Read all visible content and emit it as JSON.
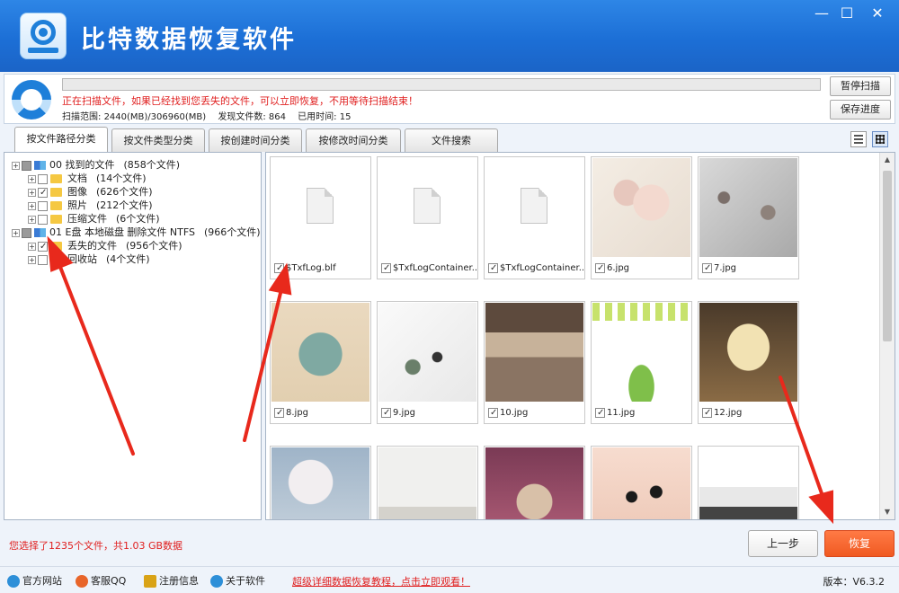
{
  "app": {
    "title": "比特数据恢复软件",
    "window_buttons": {
      "minimize": "—",
      "maximize": "☐",
      "close": "✕"
    }
  },
  "scan": {
    "progress_percent": 0,
    "message": "正在扫描文件，如果已经找到您丢失的文件，可以立即恢复，不用等待扫描结束！",
    "range_label": "扫描范围:",
    "range_value": "2440(MB)/306960(MB)",
    "found_label": "发现文件数:",
    "found_value": "864",
    "elapsed_label": "已用时间:",
    "elapsed_value": "15",
    "pause_button": "暂停扫描",
    "save_button": "保存进度"
  },
  "tabs": [
    {
      "label": "按文件路径分类",
      "active": true
    },
    {
      "label": "按文件类型分类",
      "active": false
    },
    {
      "label": "按创建时间分类",
      "active": false
    },
    {
      "label": "按修改时间分类",
      "active": false
    },
    {
      "label": "文件搜索",
      "active": false
    }
  ],
  "tree": [
    {
      "label": "00 找到的文件",
      "count": "(858个文件)",
      "level": 0,
      "icon": "drive",
      "check": "partial"
    },
    {
      "label": "文档",
      "count": "(14个文件)",
      "level": 1,
      "icon": "folder",
      "check": "off"
    },
    {
      "label": "图像",
      "count": "(626个文件)",
      "level": 1,
      "icon": "folder",
      "check": "on"
    },
    {
      "label": "照片",
      "count": "(212个文件)",
      "level": 1,
      "icon": "folder",
      "check": "off"
    },
    {
      "label": "压缩文件",
      "count": "(6个文件)",
      "level": 1,
      "icon": "folder",
      "check": "off"
    },
    {
      "label": "01 E盘 本地磁盘 删除文件 NTFS",
      "count": "(966个文件)",
      "level": 0,
      "icon": "drive",
      "check": "partial"
    },
    {
      "label": "丢失的文件",
      "count": "(956个文件)",
      "level": 1,
      "icon": "folder",
      "check": "on"
    },
    {
      "label": "回收站",
      "count": "(4个文件)",
      "level": 1,
      "icon": "folder",
      "check": "off"
    }
  ],
  "files": [
    {
      "name": "$TxfLog.blf",
      "kind": "doc"
    },
    {
      "name": "$TxfLogContainer...",
      "kind": "doc"
    },
    {
      "name": "$TxfLogContainer...",
      "kind": "doc"
    },
    {
      "name": "6.jpg",
      "kind": "flower-cream"
    },
    {
      "name": "7.jpg",
      "kind": "flower-gray"
    },
    {
      "name": "8.jpg",
      "kind": "teal-plate"
    },
    {
      "name": "9.jpg",
      "kind": "white-desk"
    },
    {
      "name": "10.jpg",
      "kind": "living-room"
    },
    {
      "name": "11.jpg",
      "kind": "green-leaves"
    },
    {
      "name": "12.jpg",
      "kind": "wedding-stage"
    },
    {
      "name": "",
      "kind": "blossom"
    },
    {
      "name": "",
      "kind": "white-room"
    },
    {
      "name": "",
      "kind": "purple-bear"
    },
    {
      "name": "",
      "kind": "nails"
    },
    {
      "name": "",
      "kind": "web-page"
    }
  ],
  "bottom": {
    "selection_info": "您选择了1235个文件，共1.03 GB数据",
    "prev_button": "上一步",
    "recover_button": "恢复"
  },
  "footer": {
    "links": [
      {
        "label": "官方网站",
        "icon": "globe-icon",
        "color": "#2d8fd8"
      },
      {
        "label": "客服QQ",
        "icon": "qq-penguin-icon",
        "color": "#e8652a"
      },
      {
        "label": "注册信息",
        "icon": "key-icon",
        "color": "#d9a316"
      },
      {
        "label": "关于软件",
        "icon": "info-icon",
        "color": "#2d8fd8"
      }
    ],
    "promo": "超级详细数据恢复教程，点击立即观看！",
    "version_label": "版本：",
    "version": "V6.3.2"
  },
  "colors": {
    "title_bar": "#1e70d8",
    "warning_text": "#e02020",
    "recover_button": "#f05a22"
  }
}
